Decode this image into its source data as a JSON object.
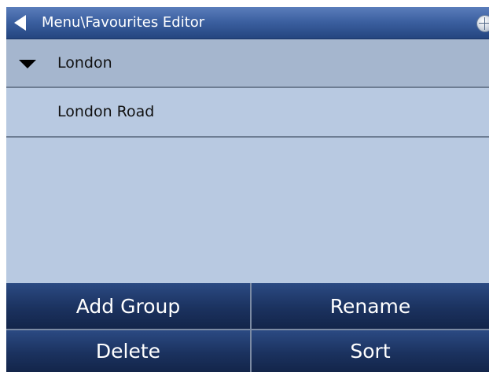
{
  "header": {
    "title": "Menu\\Favourites Editor"
  },
  "list": {
    "groups": [
      {
        "label": "London",
        "expanded": true,
        "items": [
          {
            "label": "London Road"
          }
        ]
      }
    ]
  },
  "buttons": {
    "add_group": "Add Group",
    "rename": "Rename",
    "delete": "Delete",
    "sort": "Sort"
  },
  "colors": {
    "background": "#b8c9e1",
    "selected_row": "#a5b6ce",
    "titlebar": "#3b5f9f",
    "button": "#1b325f"
  }
}
